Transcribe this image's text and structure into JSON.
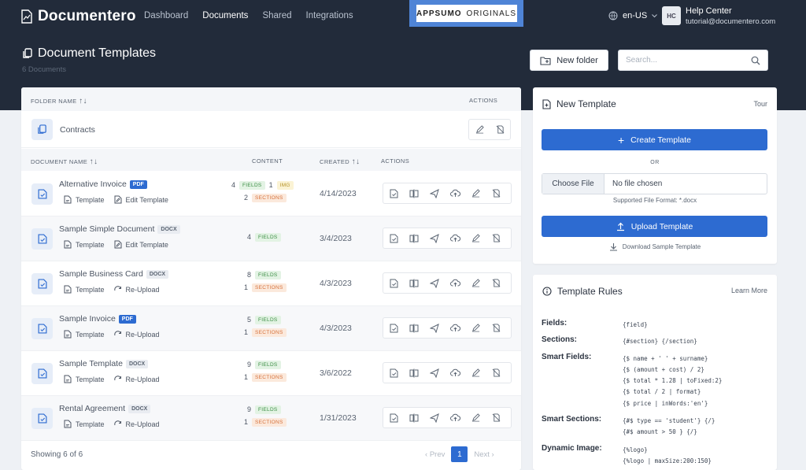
{
  "nav": {
    "brand": "Documentero",
    "links": [
      "Dashboard",
      "Documents",
      "Shared",
      "Integrations"
    ],
    "active": "Documents",
    "appsumo_left": "APPSUMO",
    "appsumo_right": "ORIGINALS",
    "language": "en-US",
    "avatar_initials": "HC",
    "help_title": "Help Center",
    "help_email": "tutorial@documentero.com"
  },
  "page": {
    "title": "Document Templates",
    "subtitle": "6 Documents",
    "new_folder_label": "New folder",
    "search_placeholder": "Search..."
  },
  "folders": {
    "header_name": "FOLDER NAME",
    "header_actions": "ACTIONS",
    "items": [
      {
        "name": "Contracts"
      }
    ]
  },
  "documents": {
    "header_name": "DOCUMENT NAME",
    "header_content": "CONTENT",
    "header_created": "CREATED",
    "header_actions": "ACTIONS",
    "rows": [
      {
        "name": "Alternative Invoice",
        "format": "PDF",
        "links": [
          "Template",
          "Edit Template"
        ],
        "content": [
          {
            "n": "4",
            "tag": "FIELDS",
            "kind": "g"
          },
          {
            "n": "1",
            "tag": "IMG",
            "kind": "y"
          },
          {
            "n": "2",
            "tag": "SECTIONS",
            "kind": "o"
          }
        ],
        "created": "4/14/2023"
      },
      {
        "name": "Sample Simple Document",
        "format": "DOCX",
        "links": [
          "Template",
          "Edit Template"
        ],
        "content": [
          {
            "n": "4",
            "tag": "FIELDS",
            "kind": "g"
          }
        ],
        "created": "3/4/2023"
      },
      {
        "name": "Sample Business Card",
        "format": "DOCX",
        "links": [
          "Template",
          "Re-Upload"
        ],
        "content": [
          {
            "n": "8",
            "tag": "FIELDS",
            "kind": "g"
          },
          {
            "n": "1",
            "tag": "SECTIONS",
            "kind": "o"
          }
        ],
        "created": "4/3/2023"
      },
      {
        "name": "Sample Invoice",
        "format": "PDF",
        "links": [
          "Template",
          "Re-Upload"
        ],
        "content": [
          {
            "n": "5",
            "tag": "FIELDS",
            "kind": "g"
          },
          {
            "n": "1",
            "tag": "SECTIONS",
            "kind": "o"
          }
        ],
        "created": "4/3/2023"
      },
      {
        "name": "Sample Template",
        "format": "DOCX",
        "links": [
          "Template",
          "Re-Upload"
        ],
        "content": [
          {
            "n": "9",
            "tag": "FIELDS",
            "kind": "g"
          },
          {
            "n": "1",
            "tag": "SECTIONS",
            "kind": "o"
          }
        ],
        "created": "3/6/2022"
      },
      {
        "name": "Rental Agreement",
        "format": "DOCX",
        "links": [
          "Template",
          "Re-Upload"
        ],
        "content": [
          {
            "n": "9",
            "tag": "FIELDS",
            "kind": "g"
          },
          {
            "n": "1",
            "tag": "SECTIONS",
            "kind": "o"
          }
        ],
        "created": "1/31/2023"
      }
    ]
  },
  "pagination": {
    "showing": "Showing 6 of 6",
    "prev": "Prev",
    "current": "1",
    "next": "Next"
  },
  "new_template": {
    "title": "New Template",
    "tour": "Tour",
    "create_label": "Create Template",
    "or": "OR",
    "choose_file": "Choose File",
    "no_file": "No file chosen",
    "supported": "Supported File Format: *.docx",
    "upload_label": "Upload Template",
    "download_sample": "Download Sample Template"
  },
  "rules": {
    "title": "Template Rules",
    "learn_more": "Learn More",
    "items": [
      {
        "label": "Fields:",
        "code": [
          "{field}"
        ]
      },
      {
        "label": "Sections:",
        "code": [
          "{#section} {/section}"
        ]
      },
      {
        "label": "Smart Fields:",
        "code": [
          "{$ name + ' ' + surname}",
          "{$ (amount + cost) / 2}",
          "{$ total * 1.28 | toFixed:2}",
          "{$ total / 2 | format}",
          "{$ price | inWords:'en'}"
        ]
      },
      {
        "label": "Smart Sections:",
        "code": [
          "{#$ type == 'student'} {/}",
          "{#$ amount > 50 } {/}"
        ]
      },
      {
        "label": "Dynamic Image:",
        "code": [
          "{%logo}",
          "{%logo | maxSize:200:150}"
        ]
      }
    ]
  },
  "colors": {
    "primary": "#2d6bd1",
    "header_bg": "#222b3a",
    "appsumo": "#4f84d6"
  }
}
